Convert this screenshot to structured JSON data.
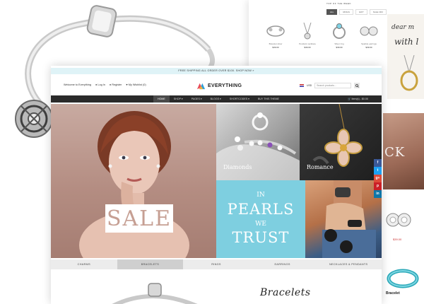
{
  "notice": "FREE SHIPPING ALL ORDER OVER $100. SHOP NOW »",
  "topbar": {
    "welcome": "Welcome to Everything",
    "login": "Log In",
    "register": "Register",
    "wishlist": "My Wishlist (0)",
    "currency": "USD",
    "search_placeholder": "Search products..."
  },
  "logo": {
    "text": "EVERYTHING"
  },
  "nav": {
    "items": [
      "HOME",
      "SHOP ▾",
      "PAGES ▾",
      "BLOGS ▾",
      "SHORTCODES ▾",
      "BUY THIS THEME"
    ],
    "cart": "Item(s) - $0.00"
  },
  "hero": {
    "sale": "SALE",
    "diamonds": "Diamonds",
    "romance": "Romance",
    "pearls": {
      "line1": "IN",
      "line2": "PEARLS",
      "line3": "WE",
      "line4": "TRUST"
    }
  },
  "social": [
    "f",
    "t",
    "g+",
    "p",
    "in"
  ],
  "social_colors": [
    "#3b5998",
    "#1da1f2",
    "#dd4b39",
    "#cb2027",
    "#0e76a8"
  ],
  "categories": [
    "CHARMS",
    "BRACELETS",
    "RINGS",
    "EARRINGS",
    "NECKLACES & PENDANTS"
  ],
  "bracelets_heading": "Bracelets",
  "back_page": {
    "title": "TOP OF THE WEEK",
    "tabs": [
      "ALL",
      "RINGS",
      "GIFT",
      "SALE OFF"
    ],
    "products": [
      {
        "name": "Bracelet silver",
        "price": "$39.00"
      },
      {
        "name": "Pendant necklace",
        "price": "$39.00"
      },
      {
        "name": "Silver ring",
        "price": "$39.00"
      },
      {
        "name": "Sparkle earrings",
        "price": "$39.00"
      }
    ],
    "promo_script": [
      "dear m",
      "with l"
    ],
    "promo_big": "CK",
    "earring_price": "$39.00",
    "bracelet_label": "Bracelet"
  },
  "colors": {
    "notice_bg": "#dff3f7",
    "nav_bg": "#2a2a2a",
    "pearls_bg": "#7ecfe0",
    "sale_text": "#c69f93",
    "cat_bar": "#ececec"
  }
}
